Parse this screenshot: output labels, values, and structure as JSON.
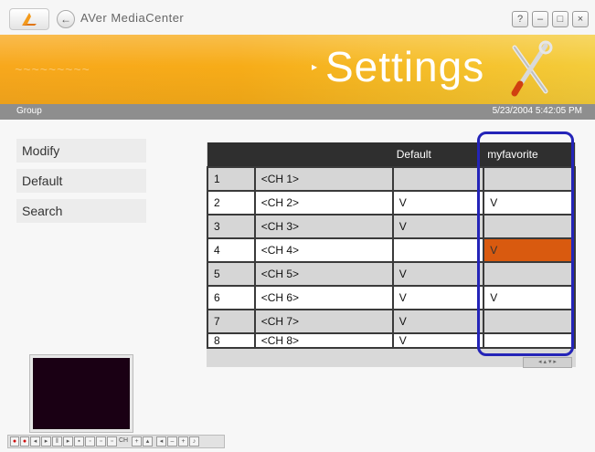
{
  "window": {
    "title": "AVer MediaCenter",
    "back_glyph": "←",
    "help_glyph": "?",
    "minimize_glyph": "–",
    "restore_glyph": "□",
    "close_glyph": "×"
  },
  "banner": {
    "arrow": "▸",
    "title": "Settings",
    "colors": {
      "banner_start": "#f8a81c",
      "banner_end": "#f4cc3a"
    }
  },
  "group_bar": {
    "label": "Group",
    "datetime": "5/23/2004 5:42:05 PM"
  },
  "side_menu": {
    "items": [
      "Modify",
      "Default",
      "Search"
    ]
  },
  "table": {
    "headers": {
      "number": "",
      "name": "",
      "default": "Default",
      "favorite": "myfavorite"
    },
    "rows": [
      {
        "num": "1",
        "name": "<CH 1>",
        "default": "",
        "favorite": ""
      },
      {
        "num": "2",
        "name": "<CH 2>",
        "default": "V",
        "favorite": "V"
      },
      {
        "num": "3",
        "name": "<CH 3>",
        "default": "V",
        "favorite": ""
      },
      {
        "num": "4",
        "name": "<CH 4>",
        "default": "",
        "favorite": "V"
      },
      {
        "num": "5",
        "name": "<CH 5>",
        "default": "V",
        "favorite": ""
      },
      {
        "num": "6",
        "name": "<CH 6>",
        "default": "V",
        "favorite": "V"
      },
      {
        "num": "7",
        "name": "<CH 7>",
        "default": "V",
        "favorite": ""
      },
      {
        "num": "8",
        "name": "<CH 8>",
        "default": "V",
        "favorite": ""
      }
    ],
    "selected_cell": {
      "row": 4,
      "column": "favorite"
    },
    "colors": {
      "selected": "#d95a0f",
      "highlight_ring": "#2424b8"
    }
  },
  "pager": {
    "label": "◂ ▴ ▾ ▸"
  },
  "controls": {
    "ch_label": "CH",
    "icons": [
      "record-icon",
      "stop-icon",
      "rewind-icon",
      "play-icon",
      "pause-icon",
      "forward-icon",
      "snapshot-icon",
      "timeshift-icon",
      "channel-up-icon",
      "channel-down-icon",
      "volume-down-icon",
      "volume-up-icon",
      "mute-icon"
    ]
  }
}
